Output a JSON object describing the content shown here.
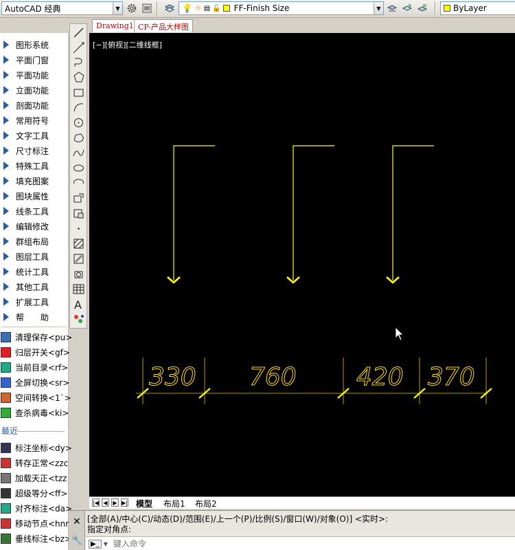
{
  "toolbar": {
    "workspace": "AutoCAD 经典",
    "layer": "FF-Finish Size",
    "color": "ByLayer"
  },
  "file_tabs": [
    "Drawing1",
    "CP-产品大样图"
  ],
  "view_label": "[−][俯视][二维线框]",
  "menu": {
    "items": [
      "图形系统",
      "平面门窗",
      "平面功能",
      "立面功能",
      "剖面功能",
      "常用符号",
      "文字工具",
      "尺寸标注",
      "特殊工具",
      "填充图案",
      "图块属性",
      "线条工具",
      "编辑修改",
      "群组布局",
      "图层工具",
      "统计工具",
      "其他工具",
      "扩展工具",
      "帮　　助"
    ],
    "tools": [
      "清理保存<pu>",
      "归层开关<gf>",
      "当前目录<rf>",
      "全屏切换<sr>",
      "空间转换<1`>",
      "查杀病毒<ki>"
    ],
    "recent_label": "最近",
    "recent": [
      "标注坐标<dy>",
      "转存正常<zzc",
      "加载天正<tzz",
      "超级等分<ff>",
      "对齐标注<da>",
      "移动节点<hnn",
      "垂线标注<bz>"
    ]
  },
  "dimensions": [
    "330",
    "760",
    "420",
    "370"
  ],
  "layout_tabs": [
    "模型",
    "布局1",
    "布局2"
  ],
  "command": {
    "line1": "[全部(A)/中心(C)/动态(D)/范围(E)/上一个(P)/比例(S)/窗口(W)/对象(O)] <实时>:",
    "line2": "指定对角点:",
    "placeholder": "键入命令"
  },
  "colors": {
    "canvas": "#000000",
    "arrow": "#ffff00",
    "dimension": "#ffdd00",
    "tab_text": "#c00000"
  }
}
